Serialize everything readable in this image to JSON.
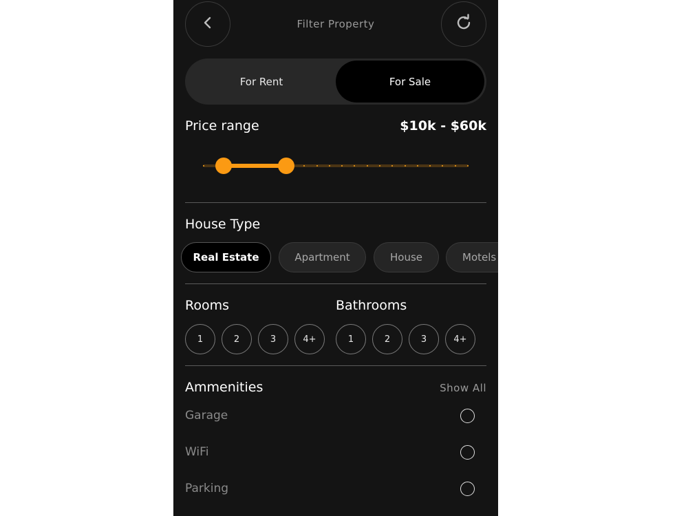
{
  "header": {
    "back_icon": "chevron-left-icon",
    "title": "Filter Property",
    "refresh_icon": "refresh-icon"
  },
  "listing_toggle": {
    "options": [
      "For Rent",
      "For Sale"
    ],
    "selected": "For Sale"
  },
  "price": {
    "label": "Price range",
    "value": "$10k - $60k",
    "slider": {
      "low_fraction": 0.05,
      "high_fraction": 0.3
    }
  },
  "house_type": {
    "label": "House Type",
    "options": [
      "Real Estate",
      "Apartment",
      "House",
      "Motels"
    ],
    "selected": "Real Estate"
  },
  "rooms": {
    "label": "Rooms",
    "options": [
      "1",
      "2",
      "3",
      "4+"
    ]
  },
  "bathrooms": {
    "label": "Bathrooms",
    "options": [
      "1",
      "2",
      "3",
      "4+"
    ]
  },
  "amenities": {
    "label": "Ammenities",
    "show_all": "Show All",
    "items": [
      {
        "label": "Garage",
        "checked": false
      },
      {
        "label": "WiFi",
        "checked": false
      },
      {
        "label": "Parking",
        "checked": false
      }
    ]
  },
  "colors": {
    "background": "#141414",
    "accent": "#fb9a13",
    "selected_bg": "#000000"
  }
}
